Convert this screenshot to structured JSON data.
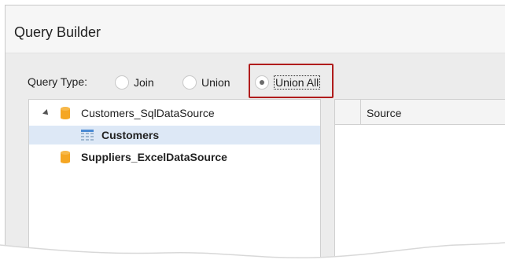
{
  "window": {
    "title": "Query Builder"
  },
  "query_type": {
    "label": "Query Type:",
    "options": [
      {
        "label": "Join",
        "checked": false
      },
      {
        "label": "Union",
        "checked": false
      },
      {
        "label": "Union All",
        "checked": true
      }
    ]
  },
  "tree": {
    "items": [
      {
        "label": "Customers_SqlDataSource",
        "bold": false,
        "icon": "database-icon",
        "expanded": true
      },
      {
        "label": "Customers",
        "bold": true,
        "icon": "table-icon",
        "selected": true
      },
      {
        "label": "Suppliers_ExcelDataSource",
        "bold": true,
        "icon": "database-icon"
      }
    ]
  },
  "grid": {
    "columns": [
      "",
      "Source"
    ]
  },
  "colors": {
    "highlight_border": "#b01c1c",
    "selection": "#dde8f6",
    "database_icon": "#f5a623"
  }
}
